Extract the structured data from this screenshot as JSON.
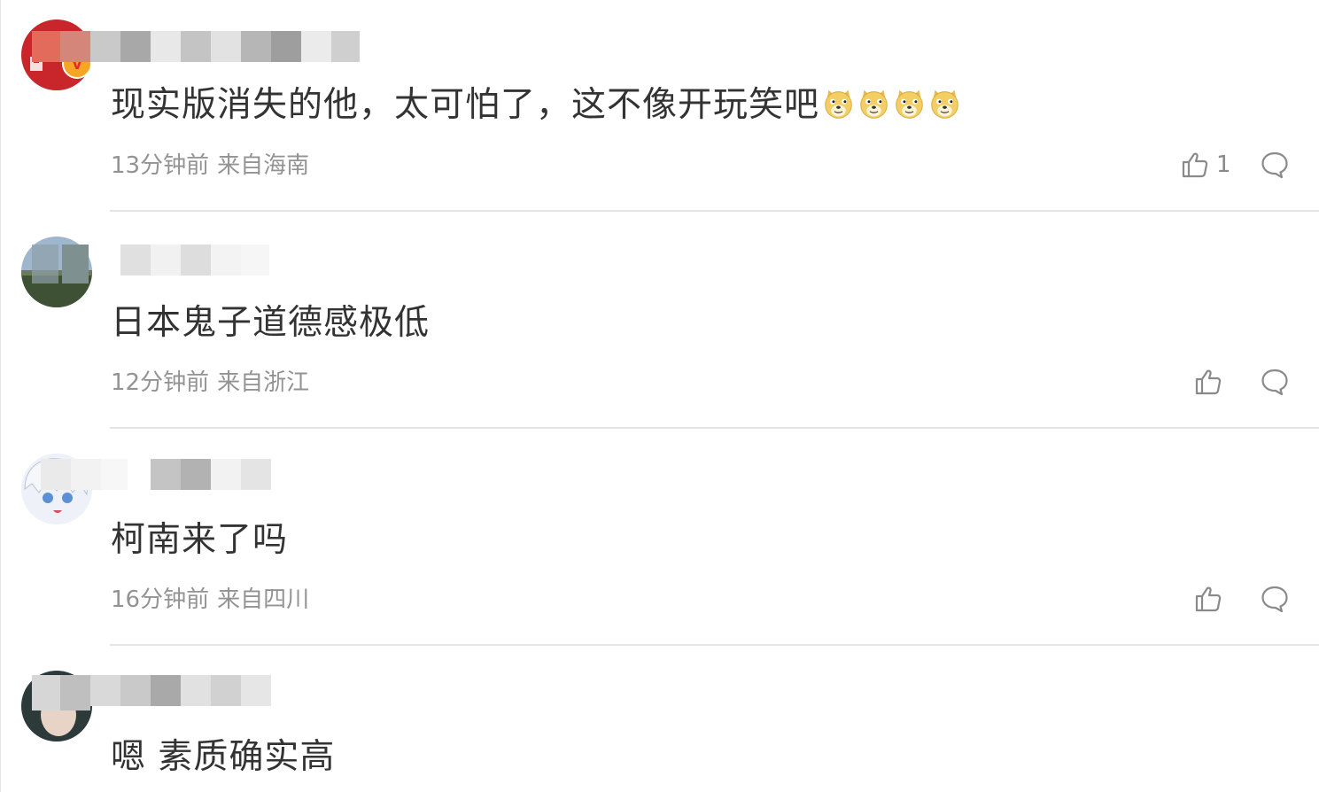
{
  "comments": [
    {
      "text": "现实版消失的他，太可怕了，这不像开玩笑吧",
      "emojis": [
        "doge-emoji",
        "doge-emoji",
        "doge-emoji",
        "doge-emoji"
      ],
      "time": "13分钟前",
      "location": "来自海南",
      "likes": "1",
      "verified_badge": "V"
    },
    {
      "text": "日本鬼子道德感极低",
      "time": "12分钟前",
      "location": "来自浙江"
    },
    {
      "text": "柯南来了吗",
      "time": "16分钟前",
      "location": "来自四川"
    },
    {
      "text": "嗯 素质确实高"
    }
  ],
  "icons": {
    "like": "thumbs-up-icon",
    "reply": "speech-bubble-icon",
    "emoji": "doge-emoji"
  },
  "colors": {
    "text_primary": "#333333",
    "text_secondary": "#939393",
    "divider": "#e4e4e4",
    "badge_gold": "#f5a623",
    "badge_red": "#e32b2b"
  }
}
